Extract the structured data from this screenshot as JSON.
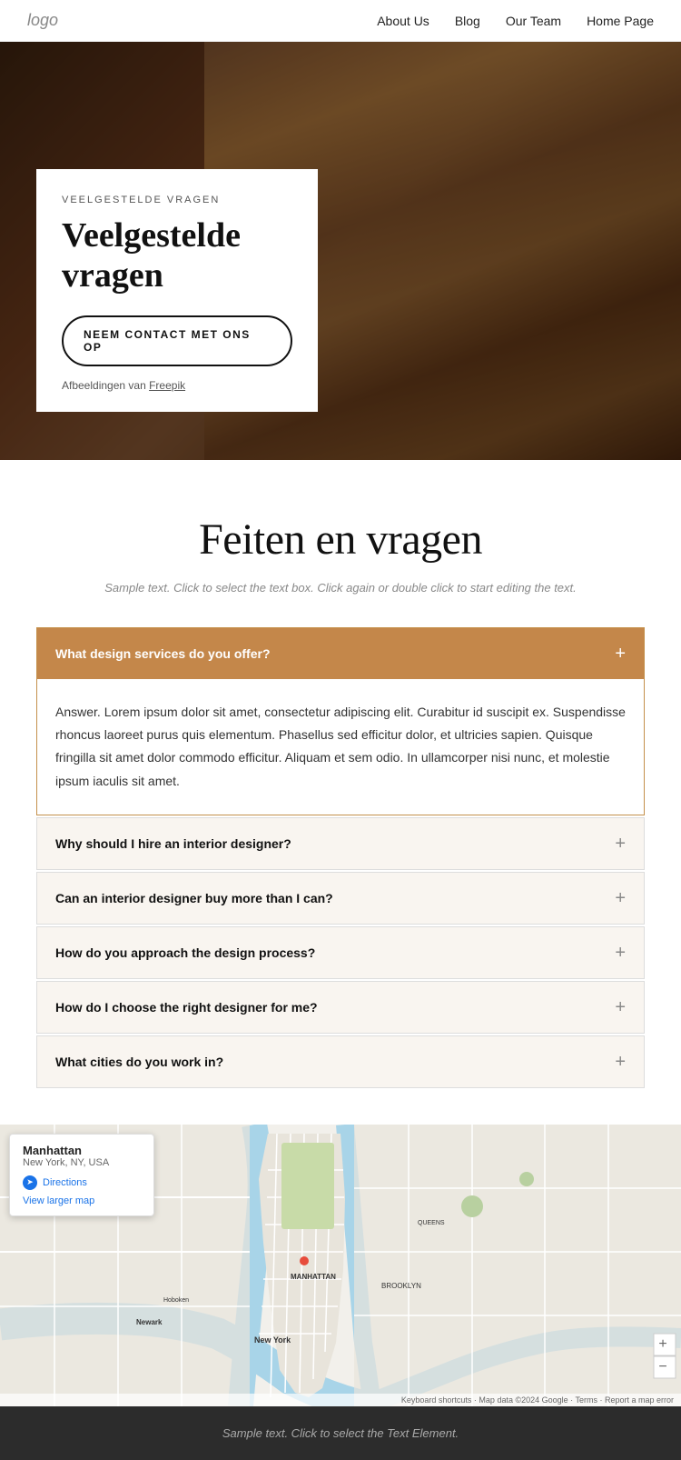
{
  "nav": {
    "logo": "logo",
    "links": [
      {
        "label": "About Us",
        "href": "#"
      },
      {
        "label": "Blog",
        "href": "#"
      },
      {
        "label": "Our Team",
        "href": "#"
      },
      {
        "label": "Home Page",
        "href": "#"
      }
    ]
  },
  "hero": {
    "label": "VEELGESTELDE VRAGEN",
    "title": "Veelgestelde vragen",
    "button_label": "NEEM CONTACT MET ONS OP",
    "credit_text": "Afbeeldingen van",
    "credit_link": "Freepik"
  },
  "main": {
    "section_title": "Feiten en vragen",
    "section_subtitle": "Sample text. Click to select the text box. Click again or double click to start editing the text.",
    "faqs": [
      {
        "question": "What design services do you offer?",
        "answer": "Answer. Lorem ipsum dolor sit amet, consectetur adipiscing elit. Curabitur id suscipit ex. Suspendisse rhoncus laoreet purus quis elementum. Phasellus sed efficitur dolor, et ultricies sapien. Quisque fringilla sit amet dolor commodo efficitur. Aliquam et sem odio. In ullamcorper nisi nunc, et molestie ipsum iaculis sit amet.",
        "active": true
      },
      {
        "question": "Why should I hire an interior designer?",
        "answer": "",
        "active": false
      },
      {
        "question": "Can an interior designer buy more than I can?",
        "answer": "",
        "active": false
      },
      {
        "question": "How do you approach the design process?",
        "answer": "",
        "active": false
      },
      {
        "question": "How do I choose the right designer for me?",
        "answer": "",
        "active": false
      },
      {
        "question": "What cities do you work in?",
        "answer": "",
        "active": false
      }
    ]
  },
  "map": {
    "popup_title": "Manhattan",
    "popup_location": "New York, NY, USA",
    "directions_label": "Directions",
    "view_larger_label": "View larger map"
  },
  "footer": {
    "text": "Sample text. Click to select the Text Element."
  },
  "map_attribution": "Keyboard shortcuts · Map data ©2024 Google · Terms · Report a map error"
}
